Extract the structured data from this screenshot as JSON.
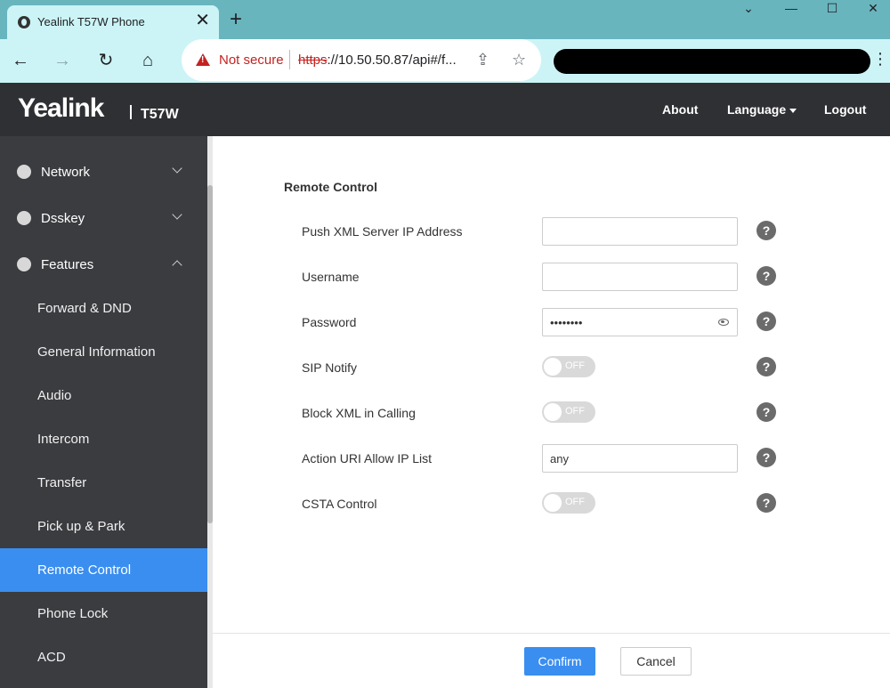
{
  "browser": {
    "tab_title": "Yealink T57W Phone",
    "security_label": "Not secure",
    "url_scheme": "https",
    "url_rest": "://10.50.50.87/api#/f..."
  },
  "header": {
    "brand": "Yealink",
    "model": "T57W",
    "about": "About",
    "language": "Language",
    "logout": "Logout"
  },
  "sidebar": {
    "groups": [
      {
        "label": "Network",
        "icon": "globe-icon",
        "expanded": false
      },
      {
        "label": "Dsskey",
        "icon": "keypad-icon",
        "expanded": false
      },
      {
        "label": "Features",
        "icon": "phone-settings-icon",
        "expanded": true
      }
    ],
    "items": [
      {
        "label": "Forward & DND"
      },
      {
        "label": "General Information"
      },
      {
        "label": "Audio"
      },
      {
        "label": "Intercom"
      },
      {
        "label": "Transfer"
      },
      {
        "label": "Pick up & Park"
      },
      {
        "label": "Remote Control",
        "active": true
      },
      {
        "label": "Phone Lock"
      },
      {
        "label": "ACD"
      }
    ]
  },
  "form": {
    "section_title": "Remote Control",
    "fields": {
      "push_xml": {
        "label": "Push XML Server IP Address",
        "value": ""
      },
      "username": {
        "label": "Username",
        "value": ""
      },
      "password": {
        "label": "Password",
        "value": "••••••••"
      },
      "sip_notify": {
        "label": "SIP Notify",
        "state": "OFF"
      },
      "block_xml": {
        "label": "Block XML in Calling",
        "state": "OFF"
      },
      "action_uri": {
        "label": "Action URI Allow IP List",
        "value": "any"
      },
      "csta": {
        "label": "CSTA Control",
        "state": "OFF"
      }
    },
    "confirm": "Confirm",
    "cancel": "Cancel"
  },
  "colors": {
    "accent": "#3a8ef0",
    "sidebar_bg": "#3b3c40",
    "header_bg": "#2f3034",
    "browser_frame": "#68b5be"
  }
}
